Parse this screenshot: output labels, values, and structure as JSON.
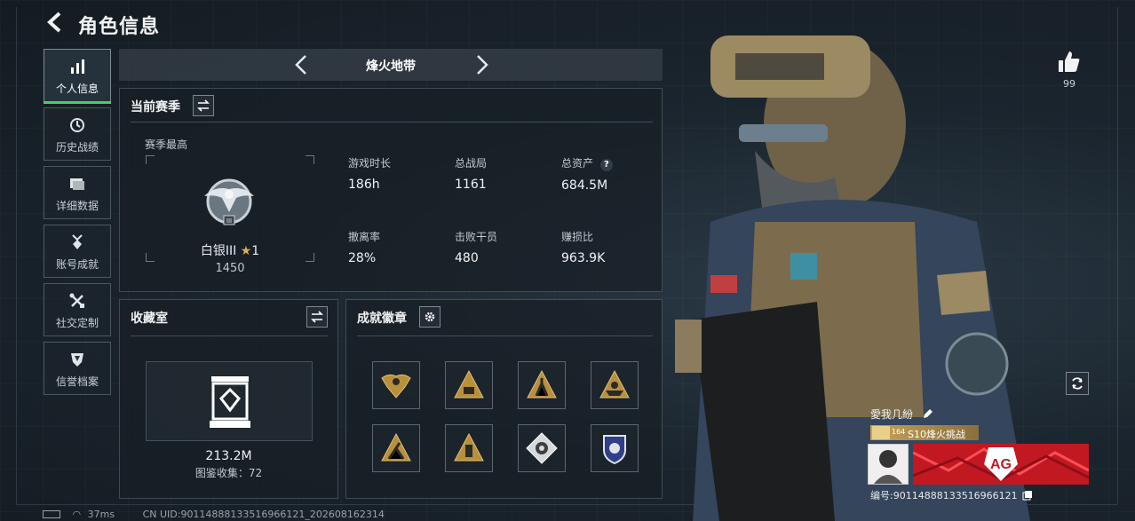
{
  "header": {
    "title": "角色信息"
  },
  "sidebar": {
    "items": [
      {
        "label": "个人信息",
        "icon": "bar-chart-icon",
        "active": true
      },
      {
        "label": "历史战绩",
        "icon": "history-icon",
        "active": false
      },
      {
        "label": "详细数据",
        "icon": "folder-icon",
        "active": false
      },
      {
        "label": "账号成就",
        "icon": "medal-icon",
        "active": false
      },
      {
        "label": "社交定制",
        "icon": "tools-icon",
        "active": false
      },
      {
        "label": "信誉档案",
        "icon": "shield-icon",
        "active": false
      }
    ]
  },
  "mode": {
    "title": "烽火地带"
  },
  "season": {
    "title": "当前赛季",
    "best_label": "赛季最高",
    "rank_name": "白银III",
    "rank_stars": "1",
    "rank_score": "1450",
    "stats": [
      {
        "label": "游戏时长",
        "value": "186h"
      },
      {
        "label": "总战局",
        "value": "1161"
      },
      {
        "label": "总资产",
        "value": "684.5M"
      },
      {
        "label": "撤离率",
        "value": "28%"
      },
      {
        "label": "击败干员",
        "value": "480"
      },
      {
        "label": "赚损比",
        "value": "963.9K"
      }
    ]
  },
  "collection": {
    "title": "收藏室",
    "value": "213.2M",
    "catalog_label": "图鉴收集：72"
  },
  "achievements": {
    "title": "成就徽章",
    "badges": [
      "badge-eagle-icon",
      "badge-triangle-icon",
      "badge-figure-icon",
      "badge-boat-icon",
      "badge-runner-icon",
      "badge-triangle-icon",
      "badge-rose-icon",
      "badge-police-icon"
    ]
  },
  "player": {
    "likes": "99",
    "name": "愛我几紛",
    "level": "164",
    "season_tag": "S10烽火挑战",
    "id_text": "编号:9011488813351696612​1"
  },
  "status_bar": {
    "ping": "37ms",
    "uid": "CN UID:9011488813351696612​1_202608162314"
  },
  "colors": {
    "accent_green": "#3cd65a",
    "gold": "#c8a458",
    "banner_red": "#d81f2a"
  }
}
